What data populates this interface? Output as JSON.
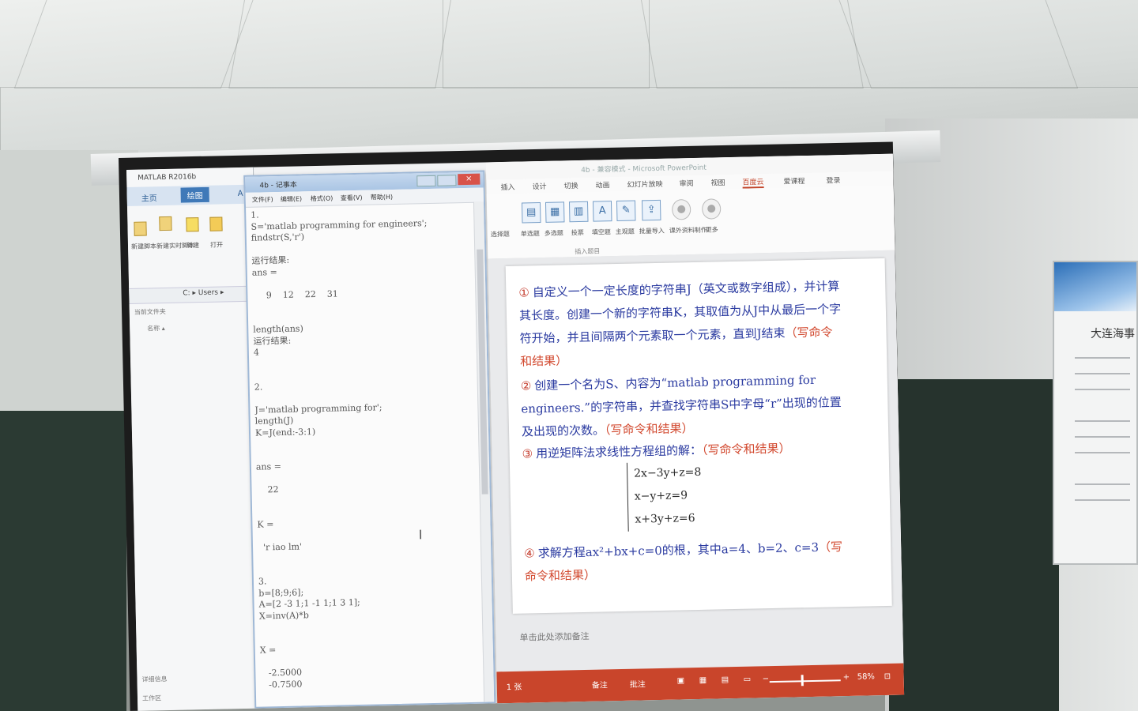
{
  "matlab": {
    "title": "MATLAB R2016b",
    "tabs": [
      "主页",
      "绘图",
      "A"
    ],
    "toolbar_labels": [
      "新建脚本",
      "新建实时脚本",
      "新建",
      "打开"
    ],
    "path": "C: ▸ Users ▸",
    "current_folder": "当前文件夹",
    "name_col": "名称 ▴",
    "details": "详细信息",
    "workspace": "工作区"
  },
  "notepad": {
    "title": "4b - 记事本",
    "menu": [
      "文件(F)",
      "编辑(E)",
      "格式(O)",
      "查看(V)",
      "帮助(H)"
    ],
    "content": "1.\nS='matlab programming for engineers';\nfindstr(S,'r')\n\n运行结果:\nans =\n\n     9    12    22    31\n\n\nlength(ans)\n运行结果:\n4\n\n\n2.\n\nJ='matlab programming for';\nlength(J)\nK=J(end:-3:1)\n\n\nans =\n\n    22\n\n\nK =\n\n  'r iao lm'\n\n\n3.\nb=[8;9;6];\nA=[2 -3 1;1 -1 1;1 3 1];\nX=inv(A)*b\n\n\nX =\n\n   -2.5000\n   -0.7500"
  },
  "ppt": {
    "title": "4b - 兼容模式 - Microsoft PowerPoint",
    "tabs": [
      "插入",
      "设计",
      "切换",
      "动画",
      "幻灯片放映",
      "审阅",
      "视图",
      "百度云",
      "爱课程",
      "登录"
    ],
    "active_tab": "百度云",
    "ribbon_items": [
      "选择题",
      "单选题",
      "多选题",
      "投票",
      "填空题",
      "主观题",
      "批量导入",
      "课外资料制作",
      "更多"
    ],
    "ribbon_group": "插入题目",
    "q1_text": "自定义一个一定长度的字符串J（英文或数字组成），并计算其长度。创建一个新的字符串K，其取值为从J中从最后一个字符开始，并且间隔两个元素取一个元素，直到J结束",
    "q1_red": "（写命令和结果）",
    "q2_text": "创建一个名为S、内容为“matlab programming for engineers.”的字符串，并查找字符串S中字母“r”出现的位置及出现的次数。",
    "q2_red": "（写命令和结果）",
    "q3_text": "用逆矩阵法求线性方程组的解：",
    "q3_red": "（写命令和结果）",
    "equations": [
      "2x−3y+z=8",
      "x−y+z=9",
      "x+3y+z=6"
    ],
    "q4_text": "求解方程ax²+bx+c=0的根，其中a=4、b=2、c=3",
    "q4_red": "（写命令和结果）",
    "nums": [
      "①",
      "②",
      "③",
      "④"
    ],
    "notes": "单击此处添加备注",
    "status": {
      "slide": "1 张",
      "notes_btn": "备注",
      "comments_btn": "批注",
      "zoom": "58%"
    }
  },
  "poster": {
    "title": "大连海事"
  }
}
